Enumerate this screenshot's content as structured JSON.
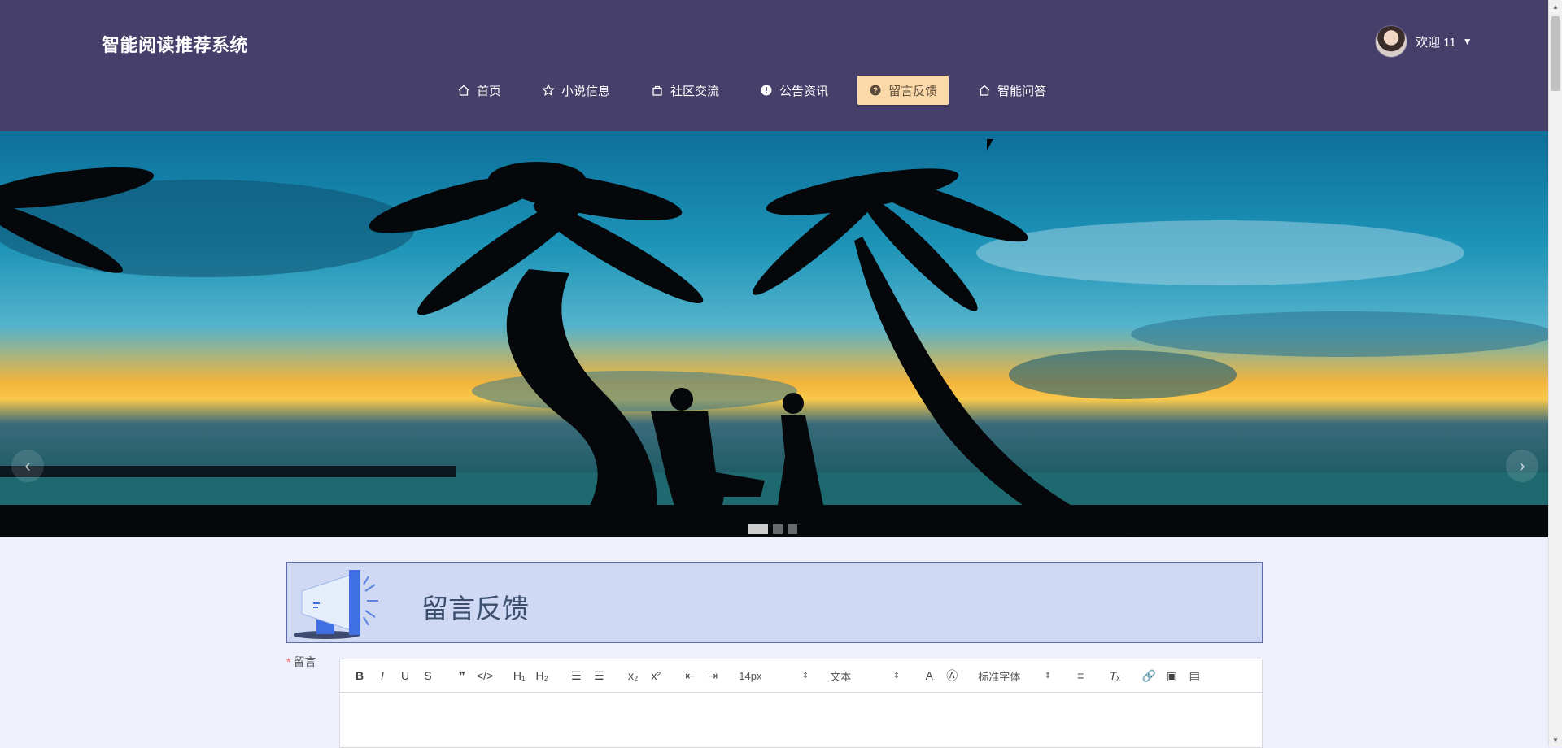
{
  "header": {
    "site_title": "智能阅读推荐系统",
    "user_greeting": "欢迎 11",
    "nav": [
      {
        "label": "首页",
        "icon": "home-icon",
        "active": false
      },
      {
        "label": "小说信息",
        "icon": "star-icon",
        "active": false
      },
      {
        "label": "社区交流",
        "icon": "bag-icon",
        "active": false
      },
      {
        "label": "公告资讯",
        "icon": "info-icon",
        "active": false
      },
      {
        "label": "留言反馈",
        "icon": "question-icon",
        "active": true
      },
      {
        "label": "智能问答",
        "icon": "home-icon",
        "active": false
      }
    ]
  },
  "carousel": {
    "prev_symbol": "‹",
    "next_symbol": "›",
    "slides": 3,
    "active_slide": 1
  },
  "feedback": {
    "title": "留言反馈",
    "field_label": "留言",
    "required_mark": "*"
  },
  "editor": {
    "font_size": "14px",
    "block_type": "文本",
    "font_family": "标准字体"
  },
  "colors": {
    "header_bg": "#453f6a",
    "nav_active_bg": "#fbd9a8",
    "page_bg": "#eef0fb",
    "feedback_banner_bg": "#cfd9f3"
  }
}
